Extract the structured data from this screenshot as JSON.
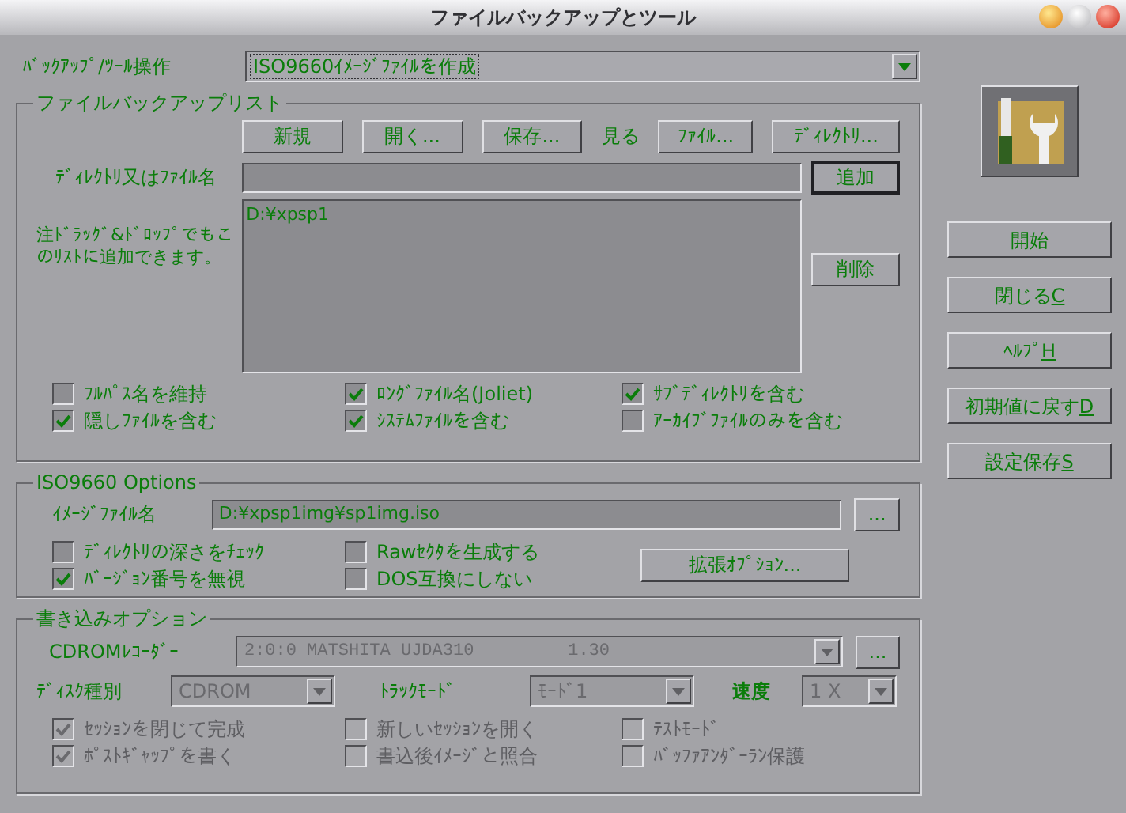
{
  "window": {
    "title": "ファイルバックアップとツール"
  },
  "operation": {
    "label": "ﾊﾞｯｸｱｯﾌﾟ/ﾂｰﾙ操作",
    "value": "ISO9660ｲﾒｰｼﾞﾌｧｲﾙを作成"
  },
  "backup_list": {
    "title": "ファイルバックアップリスト",
    "buttons": [
      "新規",
      "開く...",
      "保存..."
    ],
    "view_label": "見る",
    "view_buttons": [
      "ﾌｧｲﾙ...",
      "ﾃﾞｨﾚｸﾄﾘ..."
    ],
    "path_label": "ﾃﾞｨﾚｸﾄﾘ又はﾌｧｲﾙ名",
    "add_button": "追加",
    "note": "注ﾄﾞﾗｯｸﾞ&ﾄﾞﾛｯﾌﾟでもこのﾘｽﾄに追加できます。",
    "items": [
      "D:¥xpsp1"
    ],
    "delete_button": "削除",
    "options": [
      {
        "label": "ﾌﾙﾊﾟｽ名を維持",
        "checked": false
      },
      {
        "label": "ﾛﾝｸﾞﾌｧｲﾙ名(Joliet)",
        "checked": true
      },
      {
        "label": "ｻﾌﾞﾃﾞｨﾚｸﾄﾘを含む",
        "checked": true
      },
      {
        "label": "隠しﾌｧｲﾙを含む",
        "checked": true
      },
      {
        "label": "ｼｽﾃﾑﾌｧｲﾙを含む",
        "checked": true
      },
      {
        "label": "ｱｰｶｲﾌﾞﾌｧｲﾙのみを含む",
        "checked": false
      }
    ]
  },
  "iso_options": {
    "title": "ISO9660 Options",
    "image_label": "ｲﾒｰｼﾞﾌｧｲﾙ名",
    "image_path": "D:¥xpsp1img¥sp1img.iso",
    "browse_button": "...",
    "options": [
      {
        "label": "ﾃﾞｨﾚｸﾄﾘの深さをﾁｪｯｸ",
        "checked": false
      },
      {
        "label": "Rawｾｸﾀを生成する",
        "checked": false
      },
      {
        "label": "ﾊﾞｰｼﾞｮﾝ番号を無視",
        "checked": true
      },
      {
        "label": "DOS互換にしない",
        "checked": false
      }
    ],
    "extended_button": "拡張ｵﾌﾟｼｮﾝ..."
  },
  "write_options": {
    "title": "書き込みオプション",
    "recorder_label": "CDROMﾚｺｰﾀﾞｰ",
    "recorder": "2:0:0 MATSHITA UJDA310         1.30",
    "browse_button": "...",
    "disc_type_label": "ﾃﾞｨｽｸ種別",
    "disc_type": "CDROM",
    "track_mode_label": "ﾄﾗｯｸﾓｰﾄﾞ",
    "track_mode": "ﾓｰﾄﾞ1",
    "speed_label": "速度",
    "speed": "1 X",
    "options": [
      {
        "label": "ｾｯｼｮﾝを閉じて完成",
        "checked": true,
        "disabled": true
      },
      {
        "label": "新しいｾｯｼｮﾝを開く",
        "checked": false,
        "disabled": true
      },
      {
        "label": "ﾃｽﾄﾓｰﾄﾞ",
        "checked": false,
        "disabled": true
      },
      {
        "label": "ﾎﾟｽﾄｷﾞｬｯﾌﾟを書く",
        "checked": true,
        "disabled": true
      },
      {
        "label": "書込後ｲﾒｰｼﾞと照合",
        "checked": false,
        "disabled": true
      },
      {
        "label": "ﾊﾞｯﾌｧｱﾝﾀﾞｰﾗﾝ保護",
        "checked": false,
        "disabled": true
      }
    ]
  },
  "actions": [
    {
      "label": "開始"
    },
    {
      "label": "閉じる",
      "accel": "C"
    },
    {
      "label": "ﾍﾙﾌﾟ",
      "accel": "H"
    },
    {
      "label": "初期値に戻す",
      "accel": "D"
    },
    {
      "label": "設定保存",
      "accel": "S"
    }
  ]
}
